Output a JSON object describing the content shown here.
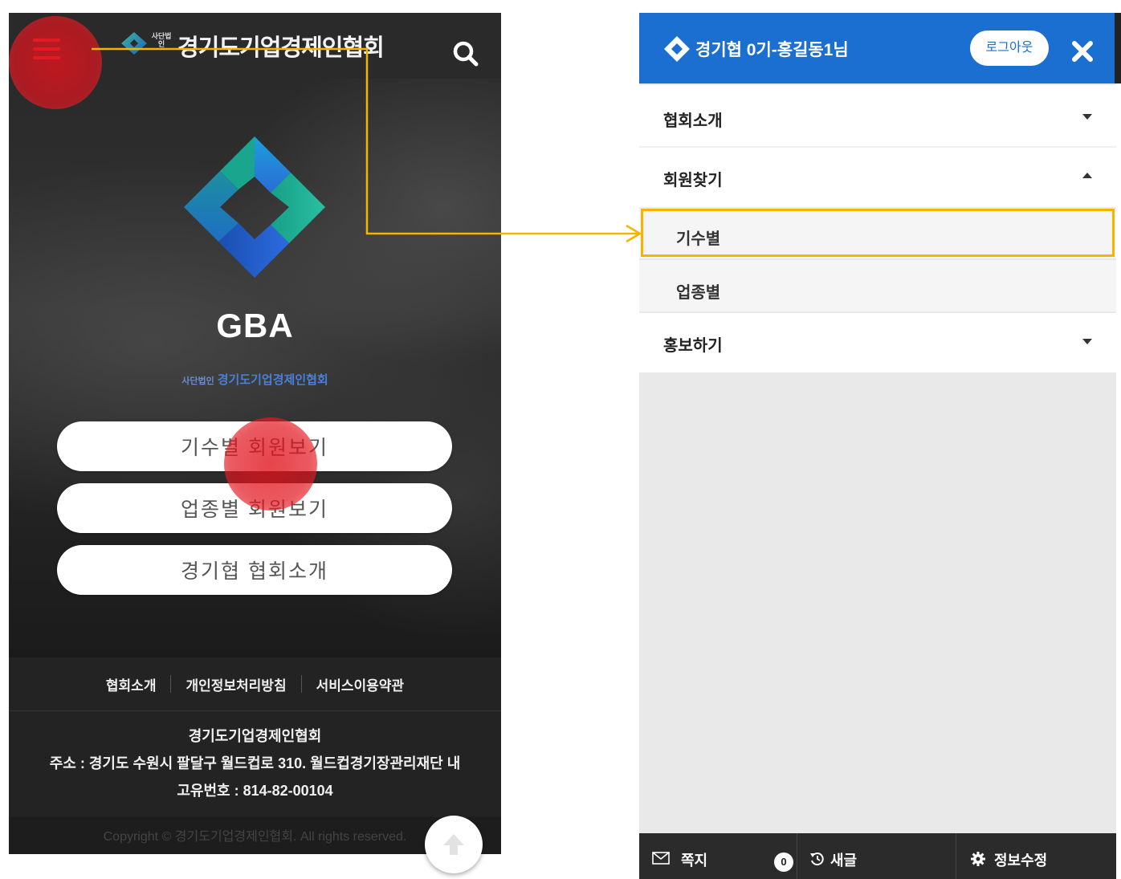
{
  "phone": {
    "header": {
      "small_tag": "사단법인",
      "title": "경기도기업경제인협회",
      "menu_icon": "hamburger-menu-icon",
      "search_icon": "search-icon"
    },
    "hero": {
      "logo_icon": "gba-diamond-logo",
      "brand": "GBA",
      "org_mark": "사단법인",
      "org_name": "경기도기업경제인협회"
    },
    "buttons": [
      {
        "label": "기수별 회원보기"
      },
      {
        "label": "업종별 회원보기"
      },
      {
        "label": "경기협 협회소개"
      }
    ],
    "footer": {
      "links": [
        "협회소개",
        "개인정보처리방침",
        "서비스이용약관"
      ],
      "org": "경기도기업경제인협회",
      "address": "주소 : 경기도 수원시 팔달구 월드컵로 310. 월드컵경기장관리재단 내",
      "reg_no": "고유번호 : 814-82-00104",
      "copyright": "Copyright © 경기도기업경제인협회. All rights reserved."
    },
    "scroll_top_icon": "arrow-up-icon"
  },
  "panel": {
    "header": {
      "user": "경기협 0기-홍길동1님",
      "logout": "로그아웃",
      "close_icon": "close-icon"
    },
    "menu": [
      {
        "label": "협회소개",
        "state": "collapsed",
        "children": []
      },
      {
        "label": "회원찾기",
        "state": "expanded",
        "children": [
          {
            "label": "기수별"
          },
          {
            "label": "업종별"
          }
        ]
      },
      {
        "label": "홍보하기",
        "state": "collapsed",
        "children": []
      }
    ],
    "footer": {
      "messages": "쪽지",
      "messages_count": "0",
      "refresh": "새글",
      "edit": "정보수정"
    }
  },
  "colors": {
    "panel_header": "#1a6fd1",
    "highlight": "#f4b400",
    "tap_indicator": "#e2141e",
    "menu_icon": "#e03030"
  }
}
